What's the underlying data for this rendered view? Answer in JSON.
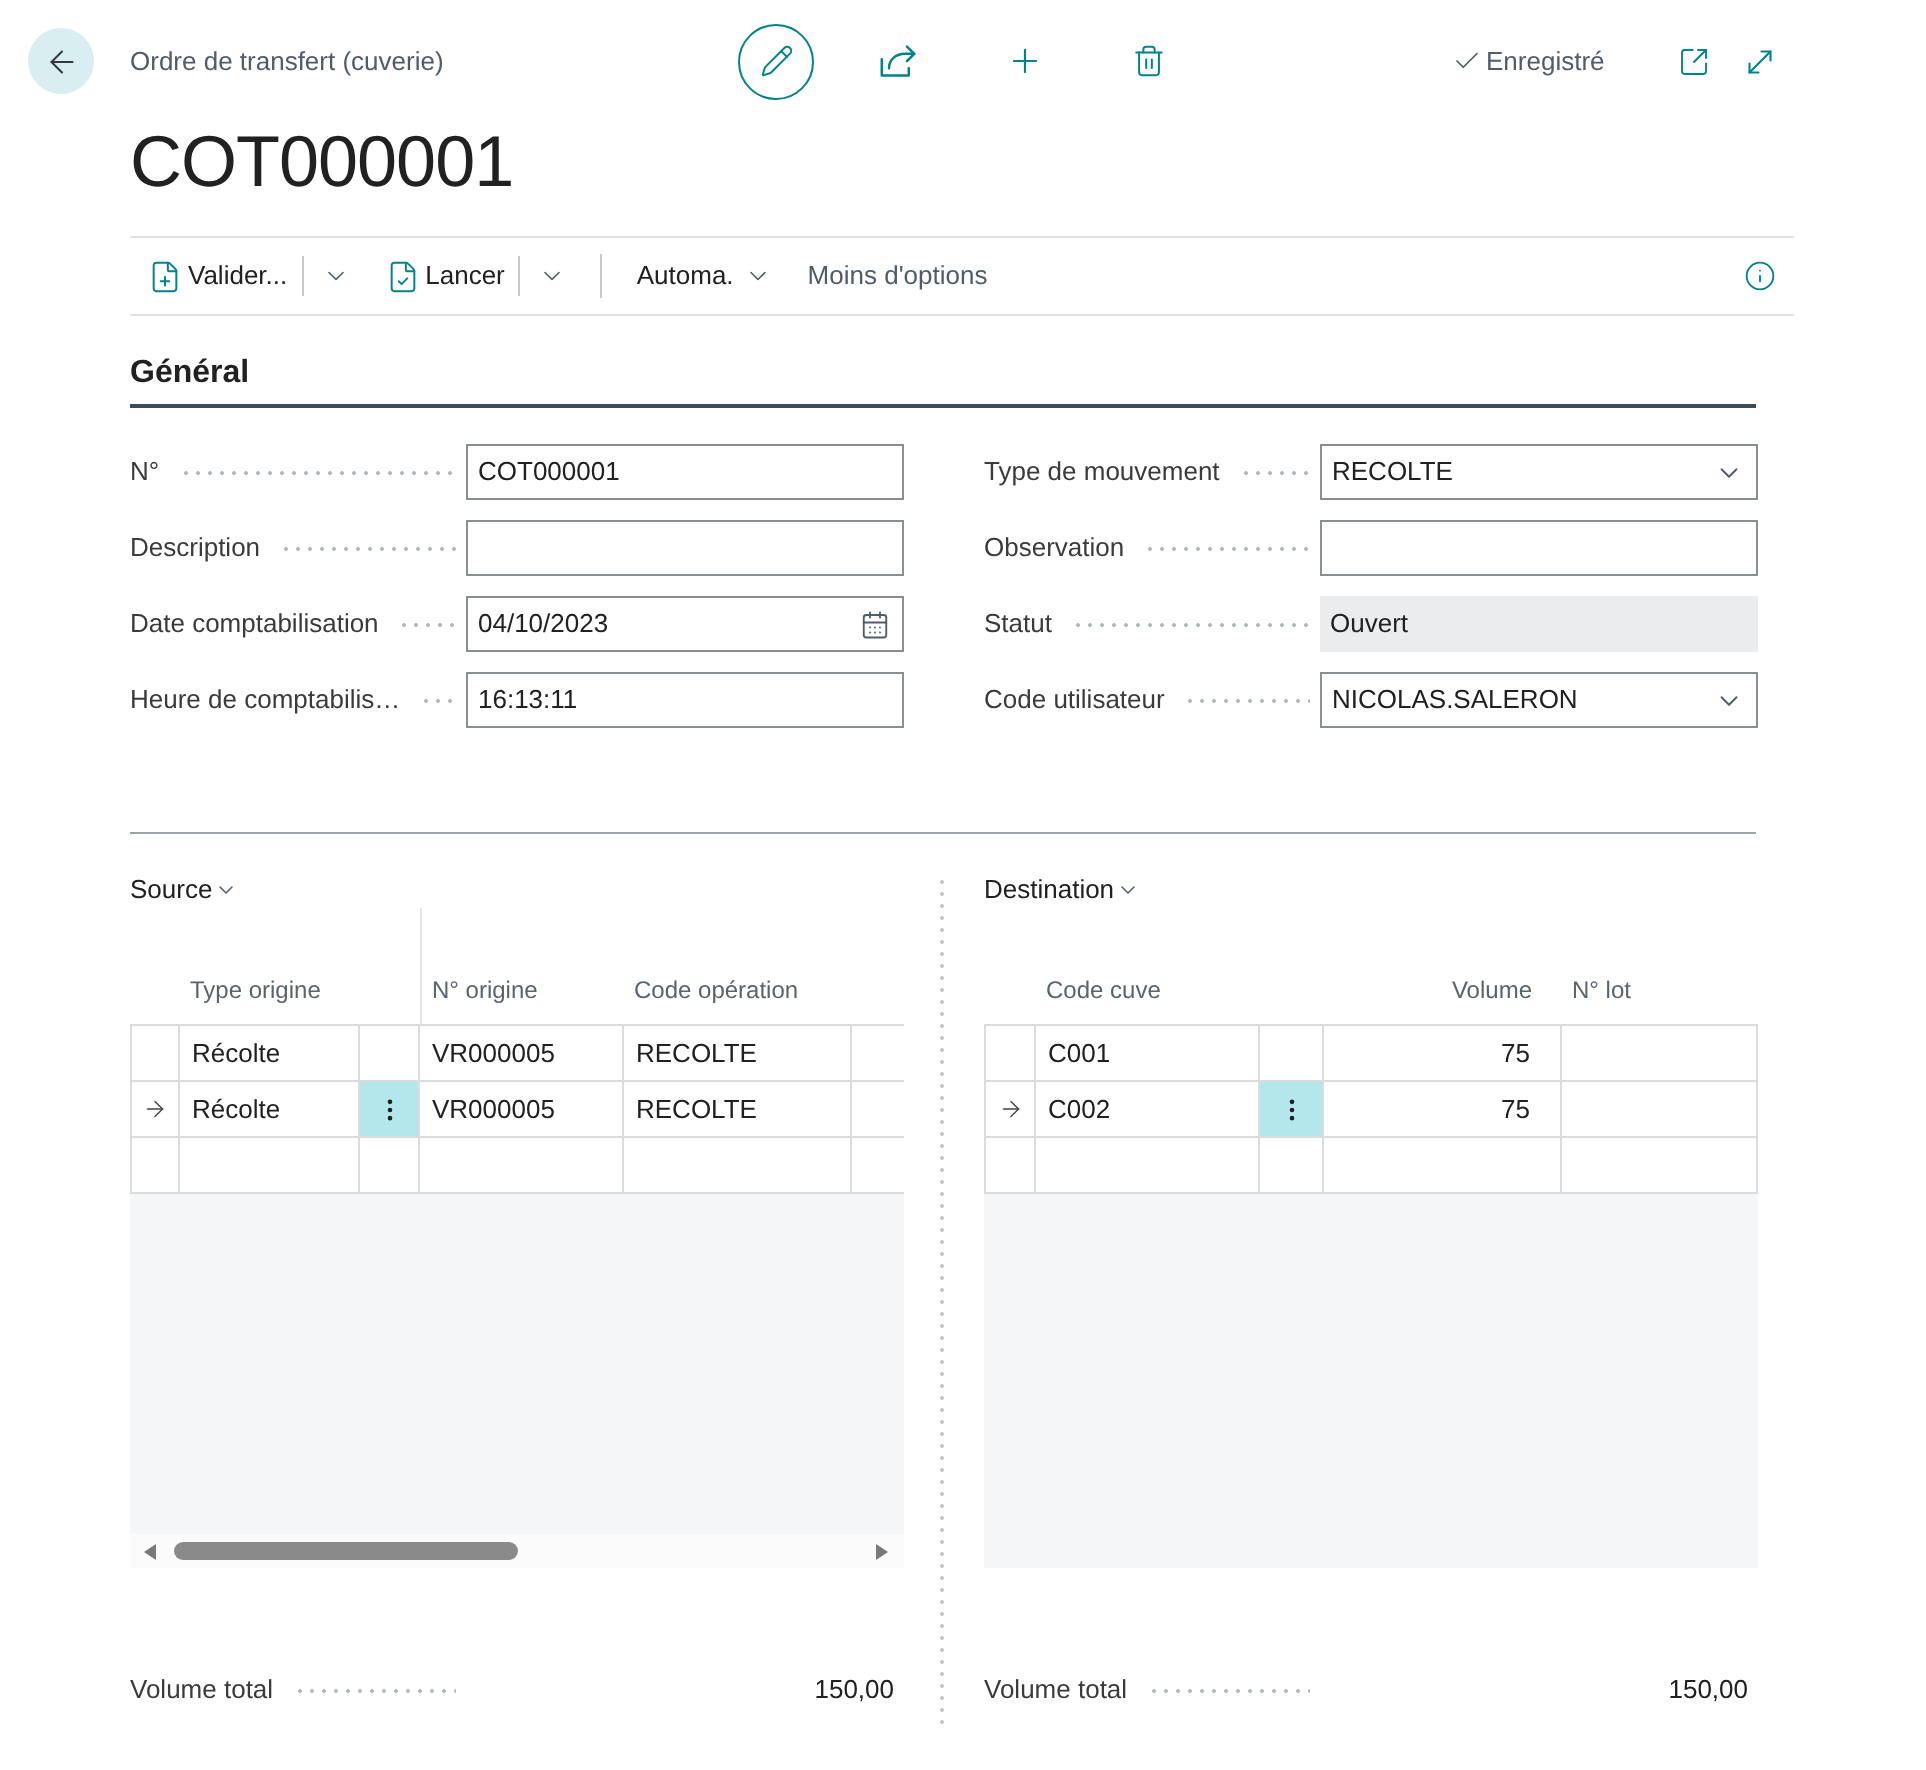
{
  "header": {
    "breadcrumb": "Ordre de transfert (cuverie)",
    "status": "Enregistré",
    "title": "COT000001"
  },
  "actions": [
    {
      "label": "Valider...",
      "kind": "split"
    },
    {
      "label": "Lancer",
      "kind": "split"
    },
    {
      "label": "Automa.",
      "kind": "menu"
    },
    {
      "label": "Moins d'options",
      "kind": "link"
    }
  ],
  "section": {
    "title": "Général"
  },
  "fields_left": [
    {
      "label": "N°",
      "value": "COT000001",
      "kind": "text"
    },
    {
      "label": "Description",
      "kind": "text"
    },
    {
      "label": "Date comptabilisation",
      "value": "04/10/2023",
      "kind": "date"
    },
    {
      "label": "Heure de comptabilis…",
      "value": "16:13:11",
      "kind": "text"
    }
  ],
  "fields_right": [
    {
      "label": "Type de mouvement",
      "value": "RECOLTE",
      "kind": "select"
    },
    {
      "label": "Observation",
      "kind": "text"
    },
    {
      "label": "Statut",
      "value": "Ouvert",
      "kind": "readonly"
    },
    {
      "label": "Code utilisateur",
      "value": "NICOLAS.SALERON",
      "kind": "select"
    }
  ],
  "parts": [
    {
      "title": "Source",
      "columns": [
        {
          "label": "Type origine",
          "kind": "text"
        },
        {
          "label": "N° origine",
          "kind": "text"
        },
        {
          "label": "Code opération",
          "kind": "text"
        }
      ],
      "rows": [
        {
          "cells": [
            "Récolte",
            "VR000005",
            "RECOLTE"
          ],
          "selected": false
        },
        {
          "cells": [
            "Récolte",
            "VR000005",
            "RECOLTE"
          ],
          "selected": true
        }
      ],
      "total": {
        "label": "Volume total",
        "value": "150,00"
      }
    },
    {
      "title": "Destination",
      "columns": [
        {
          "label": "Code cuve",
          "kind": "text"
        },
        {
          "label": "Volume",
          "kind": "number"
        },
        {
          "label": "N° lot",
          "kind": "text"
        }
      ],
      "rows": [
        {
          "cells": [
            "C001",
            "75"
          ],
          "selected": false
        },
        {
          "cells": [
            "C002",
            "75"
          ],
          "selected": true
        }
      ],
      "total": {
        "label": "Volume total",
        "value": "150,00"
      }
    }
  ]
}
